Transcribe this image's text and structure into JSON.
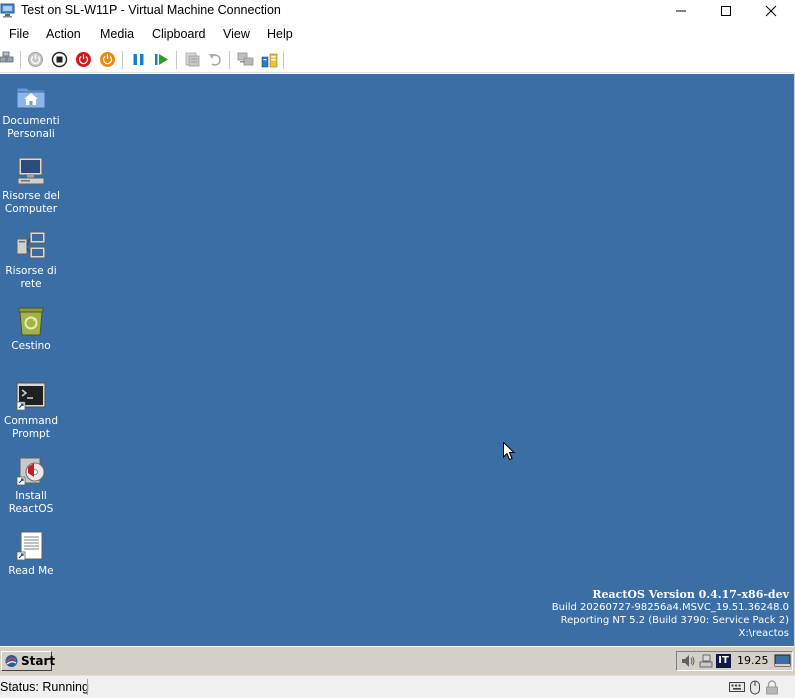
{
  "window": {
    "title": "Test on SL-W11P - Virtual Machine Connection"
  },
  "menu": {
    "items": [
      "File",
      "Action",
      "Media",
      "Clipboard",
      "View",
      "Help"
    ]
  },
  "toolbar": {
    "buttons": [
      "ctrl-alt-del",
      "start",
      "turn-off",
      "shut-down",
      "save",
      "pause",
      "resume",
      "checkpoint",
      "revert",
      "enhanced-session",
      "share"
    ]
  },
  "desktop": {
    "background": "#3a6ea5",
    "icons": [
      {
        "label": "Documenti\nPersonali",
        "icon": "home-folder-icon"
      },
      {
        "label": "Risorse del\nComputer",
        "icon": "computer-icon"
      },
      {
        "label": "Risorse di\nrete",
        "icon": "network-icon"
      },
      {
        "label": "Cestino",
        "icon": "recycle-bin-icon"
      },
      {
        "label": "Command\nPrompt",
        "icon": "command-prompt-icon"
      },
      {
        "label": "Install\nReactOS",
        "icon": "install-cd-icon"
      },
      {
        "label": "Read Me",
        "icon": "document-icon"
      }
    ],
    "version_info": {
      "title": "ReactOS Version 0.4.17-x86-dev",
      "build": "Build 20260727-98256a4.MSVC_19.51.36248.0",
      "reporting": "Reporting NT 5.2 (Build 3790: Service Pack 2)",
      "path": "X:\\reactos"
    }
  },
  "taskbar": {
    "start_label": "Start",
    "tray": {
      "language": "IT",
      "clock": "19.25",
      "icons": [
        "volume-icon",
        "network-tray-icon",
        "show-desktop-icon"
      ]
    }
  },
  "statusbar": {
    "status": "Status: Running",
    "icons": [
      "keyboard-icon",
      "mouse-icon",
      "lock-icon"
    ]
  }
}
